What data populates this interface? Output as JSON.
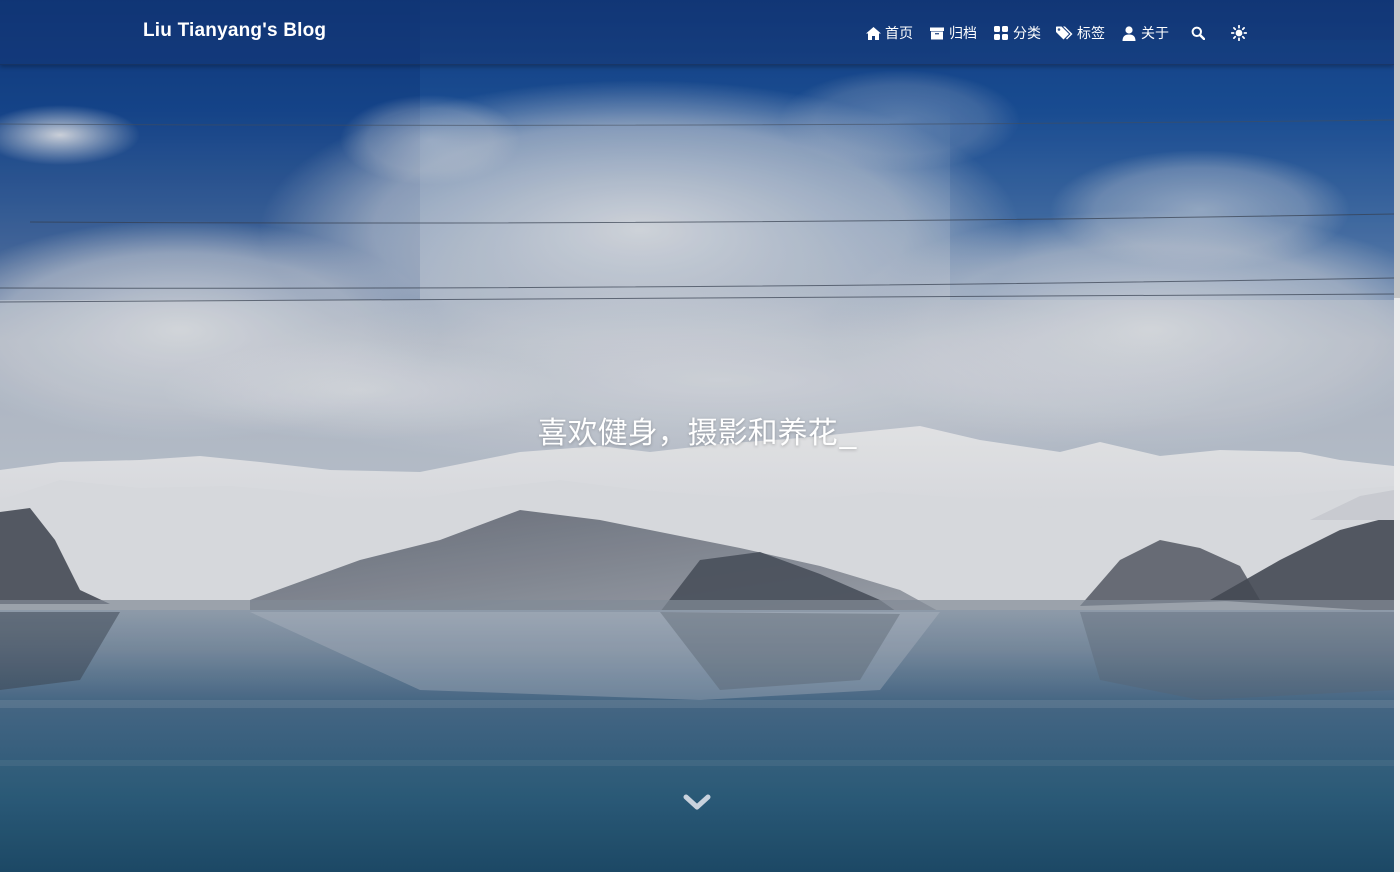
{
  "site": {
    "brand": "Liu Tianyang's Blog"
  },
  "nav": {
    "items": [
      {
        "label": "首页",
        "icon": "home-icon"
      },
      {
        "label": "归档",
        "icon": "archive-box-icon"
      },
      {
        "label": "分类",
        "icon": "grid-icon"
      },
      {
        "label": "标签",
        "icon": "tags-icon"
      },
      {
        "label": "关于",
        "icon": "user-icon"
      }
    ],
    "search_icon": "search-icon",
    "theme_icon": "sun-icon"
  },
  "banner": {
    "slogan": "喜欢健身，摄影和养花",
    "cursor": "_",
    "scroll_icon": "chevron-down-icon"
  },
  "colors": {
    "sky": "#1f4f95",
    "cloud": "#dfe3ea",
    "snow": "#eef0f3",
    "lake": "#2d5f80",
    "text": "#ffffff"
  }
}
